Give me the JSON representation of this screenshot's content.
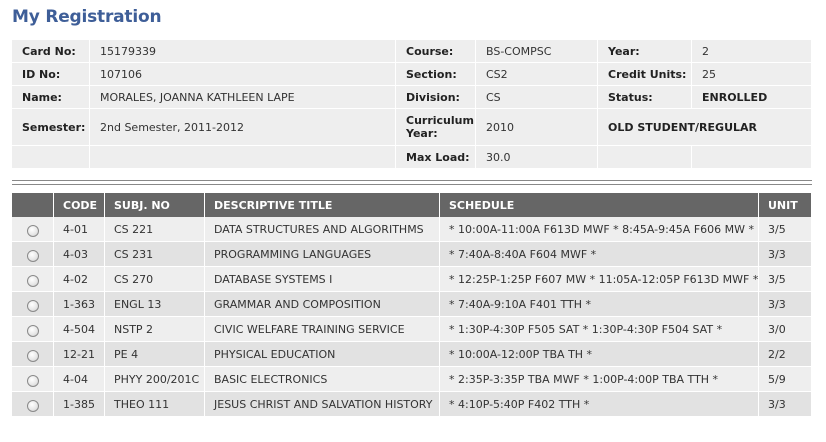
{
  "page": {
    "title": "My Registration"
  },
  "info": {
    "card_no_label": "Card No:",
    "card_no": "15179339",
    "course_label": "Course:",
    "course": "BS-COMPSC",
    "year_label": "Year:",
    "year": "2",
    "id_no_label": "ID No:",
    "id_no": "107106",
    "section_label": "Section:",
    "section": "CS2",
    "credit_units_label": "Credit Units:",
    "credit_units": "25",
    "name_label": "Name:",
    "name": "MORALES, JOANNA KATHLEEN LAPE",
    "division_label": "Division:",
    "division": "CS",
    "status_label": "Status:",
    "status": "ENROLLED",
    "semester_label": "Semester:",
    "semester": "2nd Semester, 2011-2012",
    "curriculum_year_label": "Curriculum Year:",
    "curriculum_year": "2010",
    "student_type": "OLD STUDENT/REGULAR",
    "max_load_label": "Max Load:",
    "max_load": "30.0"
  },
  "subjects": {
    "headers": [
      "CODE",
      "SUBJ. NO",
      "DESCRIPTIVE TITLE",
      "SCHEDULE",
      "UNIT"
    ],
    "rows": [
      [
        "4-01",
        "CS 221",
        "DATA STRUCTURES AND ALGORITHMS",
        "* 10:00A-11:00A F613D MWF * 8:45A-9:45A F606 MW *",
        "3/5"
      ],
      [
        "4-03",
        "CS 231",
        "PROGRAMMING LANGUAGES",
        "* 7:40A-8:40A F604 MWF *",
        "3/3"
      ],
      [
        "4-02",
        "CS 270",
        "DATABASE SYSTEMS I",
        "* 12:25P-1:25P F607 MW * 11:05A-12:05P F613D MWF *",
        "3/5"
      ],
      [
        "1-363",
        "ENGL 13",
        "GRAMMAR AND COMPOSITION",
        "* 7:40A-9:10A F401 TTH *",
        "3/3"
      ],
      [
        "4-504",
        "NSTP 2",
        "CIVIC WELFARE TRAINING SERVICE",
        "* 1:30P-4:30P F505 SAT * 1:30P-4:30P F504 SAT *",
        "3/0"
      ],
      [
        "12-21",
        "PE 4",
        "PHYSICAL EDUCATION",
        "* 10:00A-12:00P TBA TH *",
        "2/2"
      ],
      [
        "4-04",
        "PHYY 200/201C",
        "BASIC ELECTRONICS",
        "* 2:35P-3:35P TBA MWF * 1:00P-4:00P TBA TTH *",
        "5/9"
      ],
      [
        "1-385",
        "THEO 111",
        "JESUS CHRIST AND SALVATION HISTORY",
        "* 4:10P-5:40P F402 TTH *",
        "3/3"
      ]
    ]
  }
}
